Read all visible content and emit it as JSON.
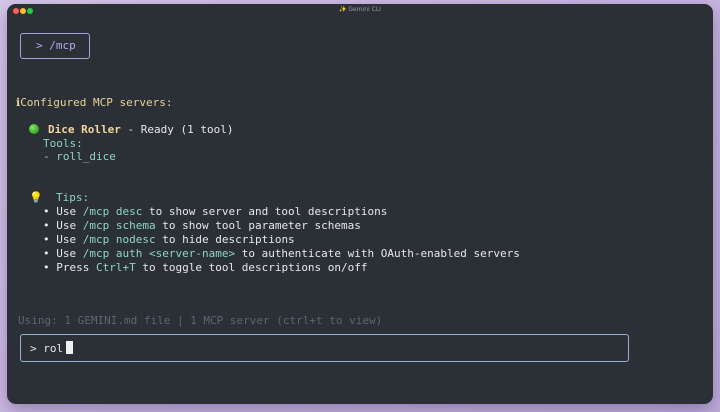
{
  "window": {
    "title": "✨ Gemini CLI"
  },
  "command": {
    "text": "> /mcp"
  },
  "output": {
    "heading": "Configured MCP servers:",
    "server": {
      "name": "Dice Roller",
      "status": " - Ready (1 tool)",
      "tools_label": "Tools:",
      "tools": [
        "- roll_dice"
      ]
    },
    "tips_label": "Tips:",
    "tips": [
      {
        "pre": "Use ",
        "cmd": "/mcp desc",
        "post": " to show server and tool descriptions"
      },
      {
        "pre": "Use ",
        "cmd": "/mcp schema",
        "post": " to show tool parameter schemas"
      },
      {
        "pre": "Use ",
        "cmd": "/mcp nodesc",
        "post": " to hide descriptions"
      },
      {
        "pre": "Use ",
        "cmd": "/mcp auth <server-name>",
        "post": " to authenticate with OAuth-enabled servers"
      },
      {
        "pre": "Press ",
        "cmd": "Ctrl+T",
        "post": " to toggle tool descriptions on/off"
      }
    ]
  },
  "status_bar": {
    "text": "Using: 1 GEMINI.md file | 1 MCP server (ctrl+t to view)"
  },
  "input": {
    "prompt": "> ",
    "value": "rol"
  },
  "colors": {
    "background": "#2b2f36",
    "accent_purple": "#b9a6ef",
    "accent_teal": "#8fd6c6",
    "accent_yellow": "#f2d79b",
    "status_green": "#3fae2a"
  },
  "icons": {
    "info": "info-icon",
    "ready": "green-circle-icon",
    "tips": "lightbulb-icon"
  }
}
